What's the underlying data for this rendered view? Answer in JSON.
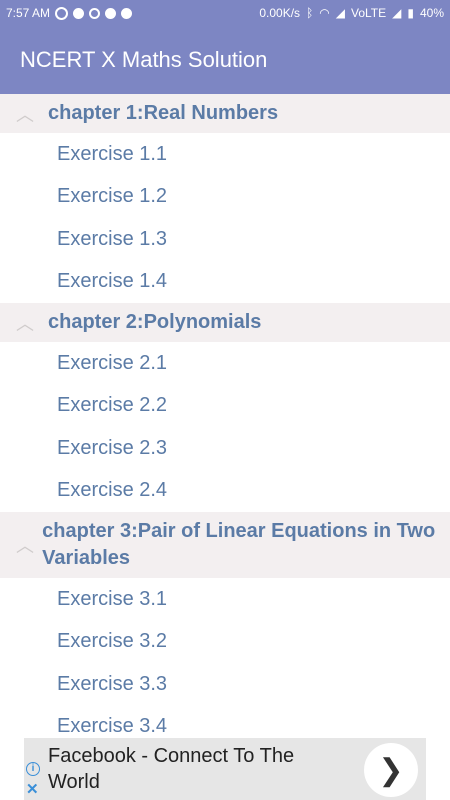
{
  "statusbar": {
    "time": "7:57 AM",
    "network_speed": "0.00K/s",
    "carrier": "VoLTE",
    "battery": "40%"
  },
  "appbar": {
    "title": "NCERT X Maths Solution"
  },
  "chapters": [
    {
      "title": "chapter 1:Real Numbers",
      "exercises": [
        "Exercise 1.1",
        "Exercise 1.2",
        "Exercise 1.3",
        "Exercise 1.4"
      ]
    },
    {
      "title": "chapter 2:Polynomials",
      "exercises": [
        "Exercise 2.1",
        "Exercise 2.2",
        "Exercise 2.3",
        "Exercise 2.4"
      ]
    },
    {
      "title": "chapter 3:Pair of Linear Equations in Two Variables",
      "exercises": [
        "Exercise 3.1",
        "Exercise 3.2",
        "Exercise 3.3",
        "Exercise 3.4"
      ]
    }
  ],
  "ad": {
    "text": "Facebook - Connect To The World",
    "info_glyph": "i",
    "close_glyph": "✕",
    "action_glyph": "❯"
  },
  "icons": {
    "collapse": "chevron-up-icon"
  },
  "colors": {
    "appbar": "#7d86c3",
    "link": "#5b7ba6",
    "group_bg": "#f3eff0"
  }
}
